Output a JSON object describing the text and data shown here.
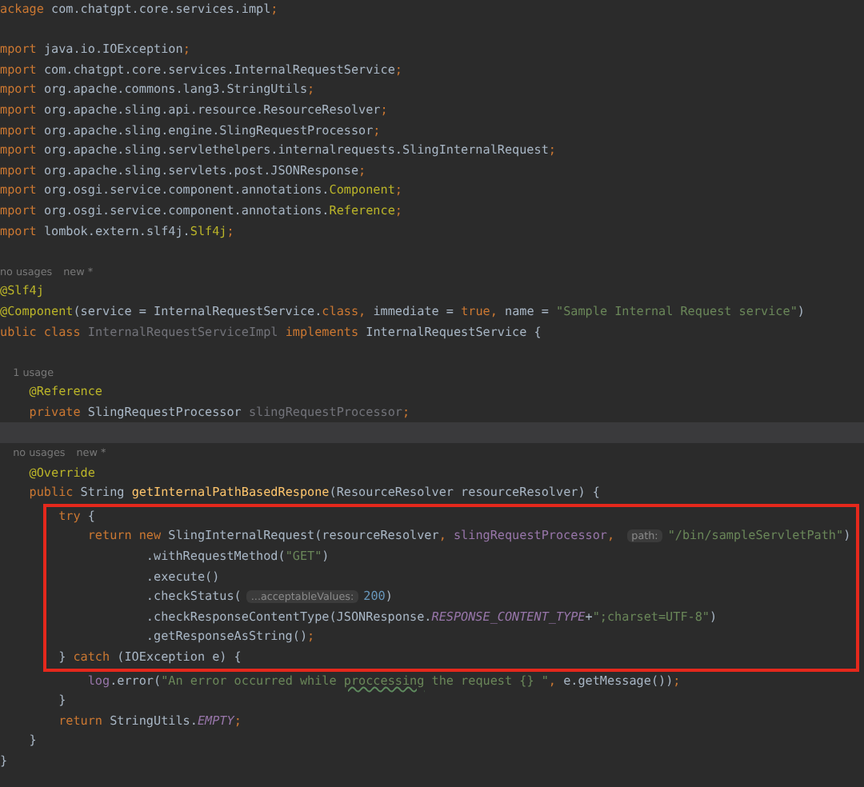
{
  "sections": [
    {
      "boxed": false,
      "lines": [
        {
          "kind": "code",
          "current": false,
          "tokens": [
            {
              "kind": "kw",
              "text": "ackage "
            },
            {
              "kind": "plain",
              "text": "com.chatgpt.core.services.impl"
            },
            {
              "kind": "kw",
              "text": ";"
            }
          ]
        },
        {
          "kind": "blank",
          "current": false
        },
        {
          "kind": "code",
          "current": false,
          "tokens": [
            {
              "kind": "kw",
              "text": "mport "
            },
            {
              "kind": "plain",
              "text": "java.io.IOException"
            },
            {
              "kind": "kw",
              "text": ";"
            }
          ]
        },
        {
          "kind": "code",
          "current": false,
          "tokens": [
            {
              "kind": "kw",
              "text": "mport "
            },
            {
              "kind": "plain",
              "text": "com.chatgpt.core.services.InternalRequestService"
            },
            {
              "kind": "kw",
              "text": ";"
            }
          ]
        },
        {
          "kind": "code",
          "current": false,
          "tokens": [
            {
              "kind": "kw",
              "text": "mport "
            },
            {
              "kind": "plain",
              "text": "org.apache.commons.lang3.StringUtils"
            },
            {
              "kind": "kw",
              "text": ";"
            }
          ]
        },
        {
          "kind": "code",
          "current": false,
          "tokens": [
            {
              "kind": "kw",
              "text": "mport "
            },
            {
              "kind": "plain",
              "text": "org.apache.sling.api.resource.ResourceResolver"
            },
            {
              "kind": "kw",
              "text": ";"
            }
          ]
        },
        {
          "kind": "code",
          "current": false,
          "tokens": [
            {
              "kind": "kw",
              "text": "mport "
            },
            {
              "kind": "plain",
              "text": "org.apache.sling.engine.SlingRequestProcessor"
            },
            {
              "kind": "kw",
              "text": ";"
            }
          ]
        },
        {
          "kind": "code",
          "current": false,
          "tokens": [
            {
              "kind": "kw",
              "text": "mport "
            },
            {
              "kind": "plain",
              "text": "org.apache.sling.servlethelpers.internalrequests.SlingInternalRequest"
            },
            {
              "kind": "kw",
              "text": ";"
            }
          ]
        },
        {
          "kind": "code",
          "current": false,
          "tokens": [
            {
              "kind": "kw",
              "text": "mport "
            },
            {
              "kind": "plain",
              "text": "org.apache.sling.servlets.post.JSONResponse"
            },
            {
              "kind": "kw",
              "text": ";"
            }
          ]
        },
        {
          "kind": "code",
          "current": false,
          "tokens": [
            {
              "kind": "kw",
              "text": "mport "
            },
            {
              "kind": "plain",
              "text": "org.osgi.service.component.annotations."
            },
            {
              "kind": "ann",
              "text": "Component"
            },
            {
              "kind": "kw",
              "text": ";"
            }
          ]
        },
        {
          "kind": "code",
          "current": false,
          "tokens": [
            {
              "kind": "kw",
              "text": "mport "
            },
            {
              "kind": "plain",
              "text": "org.osgi.service.component.annotations."
            },
            {
              "kind": "ann",
              "text": "Reference"
            },
            {
              "kind": "kw",
              "text": ";"
            }
          ]
        },
        {
          "kind": "code",
          "current": false,
          "tokens": [
            {
              "kind": "kw",
              "text": "mport "
            },
            {
              "kind": "plain",
              "text": "lombok.extern.slf4j."
            },
            {
              "kind": "ann",
              "text": "Slf4j"
            },
            {
              "kind": "kw",
              "text": ";"
            }
          ]
        },
        {
          "kind": "blank",
          "current": false
        },
        {
          "kind": "usage",
          "current": false,
          "text": "no usages",
          "note": "new *"
        },
        {
          "kind": "code",
          "current": false,
          "tokens": [
            {
              "kind": "ann",
              "text": "@Slf4j"
            }
          ]
        },
        {
          "kind": "code",
          "current": false,
          "tokens": [
            {
              "kind": "ann",
              "text": "@Component"
            },
            {
              "kind": "plain",
              "text": "(service = InternalRequestService."
            },
            {
              "kind": "kw",
              "text": "class, "
            },
            {
              "kind": "plain",
              "text": "immediate = "
            },
            {
              "kind": "kw",
              "text": "true, "
            },
            {
              "kind": "plain",
              "text": "name = "
            },
            {
              "kind": "str",
              "text": "\"Sample Internal Request service\""
            },
            {
              "kind": "plain",
              "text": ")"
            }
          ]
        },
        {
          "kind": "code",
          "current": false,
          "tokens": [
            {
              "kind": "kw",
              "text": "ublic class "
            },
            {
              "kind": "muted",
              "text": "InternalRequestServiceImpl"
            },
            {
              "kind": "kw",
              "text": " implements "
            },
            {
              "kind": "plain",
              "text": "InternalRequestService {"
            }
          ]
        },
        {
          "kind": "blank",
          "current": false
        },
        {
          "kind": "usage",
          "current": false,
          "text": "    1 usage"
        },
        {
          "kind": "code",
          "current": false,
          "tokens": [
            {
              "kind": "ann",
              "text": "    @Reference"
            }
          ]
        },
        {
          "kind": "code",
          "current": false,
          "tokens": [
            {
              "kind": "kw",
              "text": "    private "
            },
            {
              "kind": "plain",
              "text": "SlingRequestProcessor "
            },
            {
              "kind": "muted",
              "text": "slingRequestProcessor"
            },
            {
              "kind": "kw",
              "text": ";"
            }
          ]
        },
        {
          "kind": "blank",
          "current": true
        },
        {
          "kind": "usage",
          "current": false,
          "text": "    no usages",
          "note": "new *"
        },
        {
          "kind": "code",
          "current": false,
          "tokens": [
            {
              "kind": "ann",
              "text": "    @Override"
            }
          ]
        },
        {
          "kind": "code",
          "current": false,
          "tokens": [
            {
              "kind": "kw",
              "text": "    public "
            },
            {
              "kind": "plain",
              "text": "String "
            },
            {
              "kind": "decl",
              "text": "getInternalPathBasedRespone"
            },
            {
              "kind": "plain",
              "text": "(ResourceResolver resourceResolver) {"
            }
          ]
        }
      ]
    },
    {
      "boxed": true,
      "lines": [
        {
          "kind": "code",
          "current": false,
          "tokens": [
            {
              "kind": "kw",
              "text": "        try "
            },
            {
              "kind": "plain",
              "text": "{"
            }
          ]
        },
        {
          "kind": "code",
          "current": false,
          "tokens": [
            {
              "kind": "kw",
              "text": "            return new "
            },
            {
              "kind": "plain",
              "text": "SlingInternalRequest(resourceResolver"
            },
            {
              "kind": "kw",
              "text": ", "
            },
            {
              "kind": "field",
              "text": "slingRequestProcessor"
            },
            {
              "kind": "kw",
              "text": ", "
            },
            {
              "kind": "hint",
              "text": "path:"
            },
            {
              "kind": "str",
              "text": "\"/bin/sampleServletPath\""
            },
            {
              "kind": "plain",
              "text": ")"
            }
          ]
        },
        {
          "kind": "code",
          "current": false,
          "tokens": [
            {
              "kind": "plain",
              "text": "                    .withRequestMethod("
            },
            {
              "kind": "str",
              "text": "\"GET\""
            },
            {
              "kind": "plain",
              "text": ")"
            }
          ]
        },
        {
          "kind": "code",
          "current": false,
          "tokens": [
            {
              "kind": "plain",
              "text": "                    .execute()"
            }
          ]
        },
        {
          "kind": "code",
          "current": false,
          "tokens": [
            {
              "kind": "plain",
              "text": "                    .checkStatus("
            },
            {
              "kind": "hint",
              "text": "...acceptableValues:"
            },
            {
              "kind": "num",
              "text": "200"
            },
            {
              "kind": "plain",
              "text": ")"
            }
          ]
        },
        {
          "kind": "code",
          "current": false,
          "tokens": [
            {
              "kind": "plain",
              "text": "                    .checkResponseContentType(JSONResponse."
            },
            {
              "kind": "const",
              "text": "RESPONSE_CONTENT_TYPE"
            },
            {
              "kind": "plain",
              "text": "+"
            },
            {
              "kind": "str",
              "text": "\";charset=UTF-8\""
            },
            {
              "kind": "plain",
              "text": ")"
            }
          ]
        },
        {
          "kind": "code",
          "current": false,
          "tokens": [
            {
              "kind": "plain",
              "text": "                    .getResponseAsString()"
            },
            {
              "kind": "kw",
              "text": ";"
            }
          ]
        },
        {
          "kind": "code",
          "current": false,
          "tokens": [
            {
              "kind": "plain",
              "text": "        } "
            },
            {
              "kind": "kw",
              "text": "catch "
            },
            {
              "kind": "plain",
              "text": "(IOException e) {"
            }
          ]
        }
      ]
    },
    {
      "boxed": false,
      "lines": [
        {
          "kind": "code",
          "current": false,
          "tokens": [
            {
              "kind": "field",
              "text": "            log"
            },
            {
              "kind": "plain",
              "text": ".error("
            },
            {
              "kind": "str",
              "text": "\"An error occurred while "
            },
            {
              "kind": "typo",
              "text": "proccessing"
            },
            {
              "kind": "str",
              "text": " the request {} \""
            },
            {
              "kind": "kw",
              "text": ", "
            },
            {
              "kind": "plain",
              "text": "e.getMessage())"
            },
            {
              "kind": "kw",
              "text": ";"
            }
          ]
        },
        {
          "kind": "code",
          "current": false,
          "tokens": [
            {
              "kind": "plain",
              "text": "        }"
            }
          ]
        },
        {
          "kind": "code",
          "current": false,
          "tokens": [
            {
              "kind": "kw",
              "text": "        return "
            },
            {
              "kind": "plain",
              "text": "StringUtils."
            },
            {
              "kind": "const",
              "text": "EMPTY"
            },
            {
              "kind": "kw",
              "text": ";"
            }
          ]
        },
        {
          "kind": "code",
          "current": false,
          "tokens": [
            {
              "kind": "plain",
              "text": "    }"
            }
          ]
        },
        {
          "kind": "code",
          "current": false,
          "tokens": [
            {
              "kind": "plain",
              "text": "}"
            }
          ]
        }
      ]
    }
  ]
}
